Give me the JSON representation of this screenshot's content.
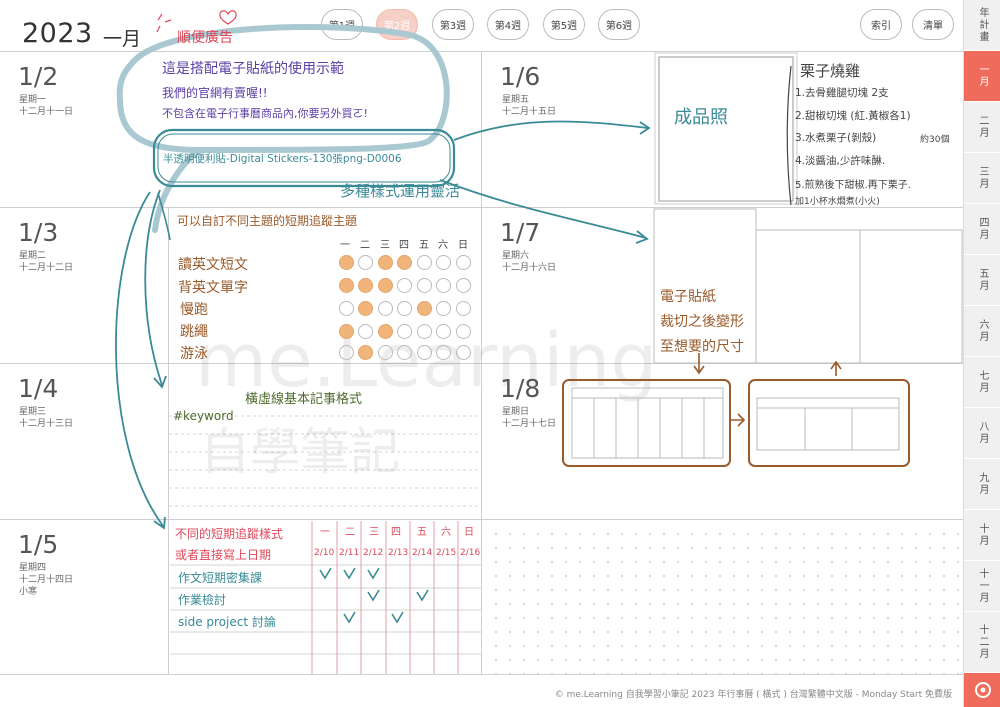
{
  "header": {
    "year": "2023",
    "month": "一月",
    "weeks": [
      "第1週",
      "第2週",
      "第3週",
      "第4週",
      "第5週",
      "第6週"
    ],
    "index_label": "索引",
    "list_label": "清單"
  },
  "days": [
    {
      "num": "1/2",
      "weekday": "星期一",
      "lunar": "十二月十一日",
      "extra": ""
    },
    {
      "num": "1/3",
      "weekday": "星期二",
      "lunar": "十二月十二日",
      "extra": ""
    },
    {
      "num": "1/4",
      "weekday": "星期三",
      "lunar": "十二月十三日",
      "extra": ""
    },
    {
      "num": "1/5",
      "weekday": "星期四",
      "lunar": "十二月十四日",
      "extra": "小寒"
    },
    {
      "num": "1/6",
      "weekday": "星期五",
      "lunar": "十二月十五日",
      "extra": ""
    },
    {
      "num": "1/7",
      "weekday": "星期六",
      "lunar": "十二月十六日",
      "extra": ""
    },
    {
      "num": "1/8",
      "weekday": "星期日",
      "lunar": "十二月十七日",
      "extra": ""
    }
  ],
  "sidebar": {
    "top": "年計畫",
    "months": [
      "一月",
      "二月",
      "三月",
      "四月",
      "五月",
      "六月",
      "七月",
      "八月",
      "九月",
      "十月",
      "十一月",
      "十二月"
    ]
  },
  "footer": "© me.Learning 自我學習小筆記 2023 年行事曆 ( 橫式 ) 台灣繁體中文版 - Monday Start 免費版",
  "watermark": {
    "line1": "me.Learning",
    "line2": "自學筆記"
  },
  "notes": {
    "ad_title": "順便廣告",
    "ad_line1": "這是搭配電子貼紙的使用示範",
    "ad_line2": "我們的官網有賣喔!!",
    "ad_line3": "不包含在電子行事曆商品內,你要另外買ㄛ!",
    "sticker_product": "半透明便利貼-Digital Stickers-130張png-D0006",
    "versatile": "多種樣式運用靈活",
    "habit_title": "可以自訂不同主題的短期追蹤主題",
    "habit_days": [
      "一",
      "二",
      "三",
      "四",
      "五",
      "六",
      "日"
    ],
    "habits": [
      "讀英文短文",
      "背英文單字",
      "慢跑",
      "跳繩",
      "游泳"
    ],
    "keyword_title": "橫虛線基本記事格式",
    "keyword": "#keyword",
    "tracker_title1": "不同的短期追蹤樣式",
    "tracker_title2": "或者直接寫上日期",
    "tracker_days": [
      "一",
      "二",
      "三",
      "四",
      "五",
      "六",
      "日"
    ],
    "tracker_dates": [
      "2/10",
      "2/11",
      "2/12",
      "2/13",
      "2/14",
      "2/15",
      "2/16"
    ],
    "tasks": [
      "作文短期密集課",
      "作業檢討",
      "side project 討論"
    ],
    "photo_label": "成品照",
    "recipe_title": "栗子燒雞",
    "recipe_steps": [
      "1.去骨雞腿切塊 2支",
      "2.甜椒切塊 (紅.黃椒各1)",
      "3.水煮栗子(剝殼)",
      "4.淡醬油,少許味醂.",
      "5.煎熟後下甜椒.再下栗子.",
      "加1小杯水燜煮(小火)"
    ],
    "recipe_amount": "約30個",
    "sticker_note1": "電子貼紙",
    "sticker_note2": "裁切之後變形",
    "sticker_note3": "至想要的尺寸"
  },
  "colors": {
    "accent": "#ef6b5c",
    "purple": "#5b3fa6",
    "teal": "#3a8a97",
    "brown": "#9b5a2a",
    "red": "#e0485a"
  }
}
